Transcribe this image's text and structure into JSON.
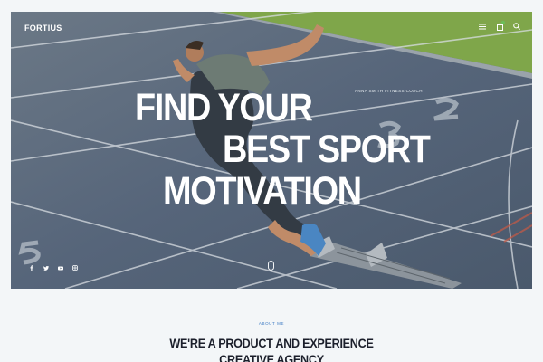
{
  "header": {
    "logo": "FORTIUS",
    "icons": [
      "menu-icon",
      "cart-icon",
      "search-icon"
    ]
  },
  "hero": {
    "coach_label": "ANNA SMITH FITNESS COACH",
    "headline": [
      "FIND YOUR",
      "BEST SPORT",
      "MOTIVATION"
    ],
    "social_icons": [
      "facebook-icon",
      "twitter-icon",
      "youtube-icon",
      "instagram-icon"
    ],
    "track_numbers": [
      "2",
      "3",
      "5"
    ]
  },
  "about": {
    "label": "ABOUT ME",
    "title_lines": [
      "WE'RE A PRODUCT AND EXPERIENCE",
      "CREATIVE AGENCY"
    ]
  },
  "colors": {
    "accent": "#3f7cc4",
    "grass": "#7fa64a",
    "track": "#5b6a78",
    "heading": "#1b1f2b"
  }
}
